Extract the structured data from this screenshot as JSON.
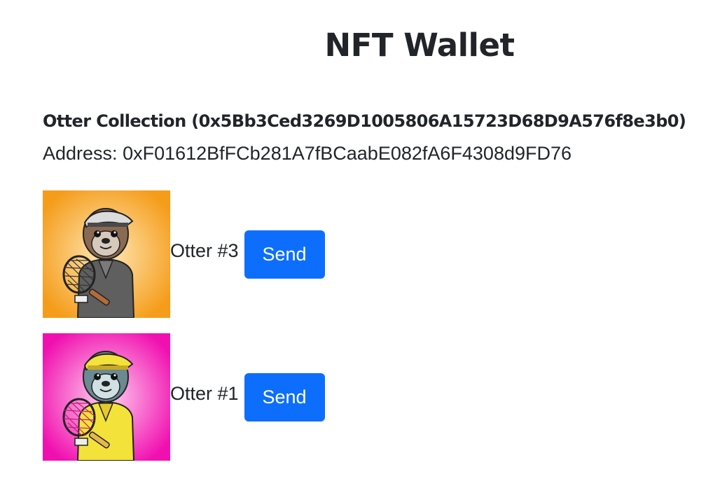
{
  "header": {
    "title": "NFT Wallet"
  },
  "collection": {
    "name": "Otter Collection (0x5Bb3Ced3269D1005806A15723D68D9A576f8e3b0)",
    "address_label": "Address:",
    "address_value": "0xF01612BfFCb281A7fBCaabE082fA6F4308d9FD76"
  },
  "nfts": [
    {
      "name": "Otter #3",
      "send_label": "Send",
      "image_icon": "otter-nft-image",
      "background_colors": [
        "#F59C1A",
        "#FFE9B8"
      ],
      "shirt_color": "#5F5F5F",
      "cap_color": "#DCDCDC"
    },
    {
      "name": "Otter #1",
      "send_label": "Send",
      "image_icon": "otter-nft-image",
      "background_colors": [
        "#F010B0",
        "#FFD2F0"
      ],
      "shirt_color": "#F3E23A",
      "cap_color": "#F3E23A"
    }
  ],
  "colors": {
    "accent": "#0D6EFD",
    "text": "#212529",
    "background": "#FFFFFF"
  }
}
